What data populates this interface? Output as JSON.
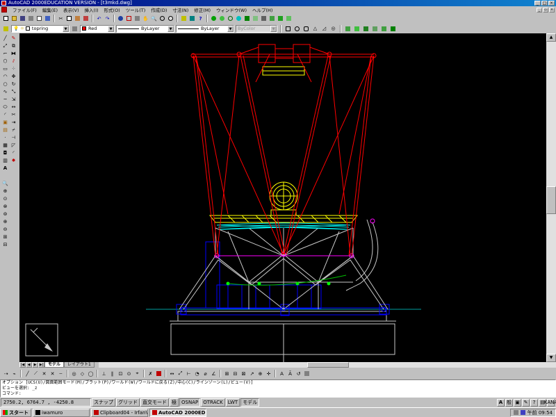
{
  "window": {
    "title": "AutoCAD 2000EDUCATION VERSION - [t3mkd.dwg]"
  },
  "menu": [
    "ファイル(F)",
    "編集(E)",
    "表示(V)",
    "挿入(I)",
    "形式(O)",
    "ツール(T)",
    "作成(D)",
    "寸法(N)",
    "修正(M)",
    "ウィンドウ(W)",
    "ヘルプ(H)"
  ],
  "properties": {
    "layer": "topring",
    "color": "Red",
    "color_hex": "#ff0000",
    "linetype": "ByLayer",
    "lineweight": "ByLayer",
    "plotstyle": "ByColor"
  },
  "tabs": [
    "モデル",
    "レイアウト1"
  ],
  "command_lines": [
    "オプション [UCS(U)/図面範囲モード(M)/プラット(P)/ワールド(W)/ワールドに戻る(Z)/中心(C)/ラインゾーン(L)/ビュー(V)]",
    "ビューを選択: _z",
    "コマンド:"
  ],
  "status": {
    "coords": "2750.2, 6764.7 , -4250.8",
    "toggles": [
      "スナップ",
      "グリッド",
      "直交モード",
      "極",
      "OSNAP",
      "OTRACK",
      "LWT",
      "モデル"
    ]
  },
  "taskbar": {
    "start": "スタート",
    "tasks": [
      {
        "label": "iwamuro",
        "active": false
      },
      {
        "label": "Clipboard04 - IrfanView",
        "active": false
      },
      {
        "label": "AutoCAD 2000EDUC...",
        "active": true
      }
    ],
    "clock": "午前 09:54"
  },
  "colors": {
    "truss_red": "#ff0000",
    "mirror_yellow": "#ffff00",
    "mirror_cyan": "#00ffff",
    "frame_white": "#c8c8c8",
    "mount_blue": "#0000ff",
    "node_magenta": "#ff00ff",
    "node_green": "#00ff00",
    "ground_teal": "#00a0a0"
  },
  "icons": {
    "standard": [
      "new-icon",
      "open-icon",
      "save-icon",
      "print-icon",
      "preview-icon",
      "spell-icon",
      "cut-icon",
      "copy-icon",
      "paste-icon",
      "matchprop-icon",
      "undo-icon",
      "redo-icon",
      "hyperlink-icon",
      "snap-icon",
      "ucs-icon",
      "pan-icon",
      "zoom-realtime-icon",
      "zoom-window-icon",
      "zoom-previous-icon",
      "properties-icon",
      "designcenter-icon",
      "help-icon"
    ],
    "draw": [
      "line-icon",
      "xline-icon",
      "pline-icon",
      "polygon-icon",
      "rectangle-icon",
      "arc-icon",
      "circle-icon",
      "spline-icon",
      "ellipse-icon",
      "insert-icon",
      "block-icon",
      "point-icon",
      "hatch-icon",
      "region-icon",
      "mtext-icon"
    ]
  }
}
